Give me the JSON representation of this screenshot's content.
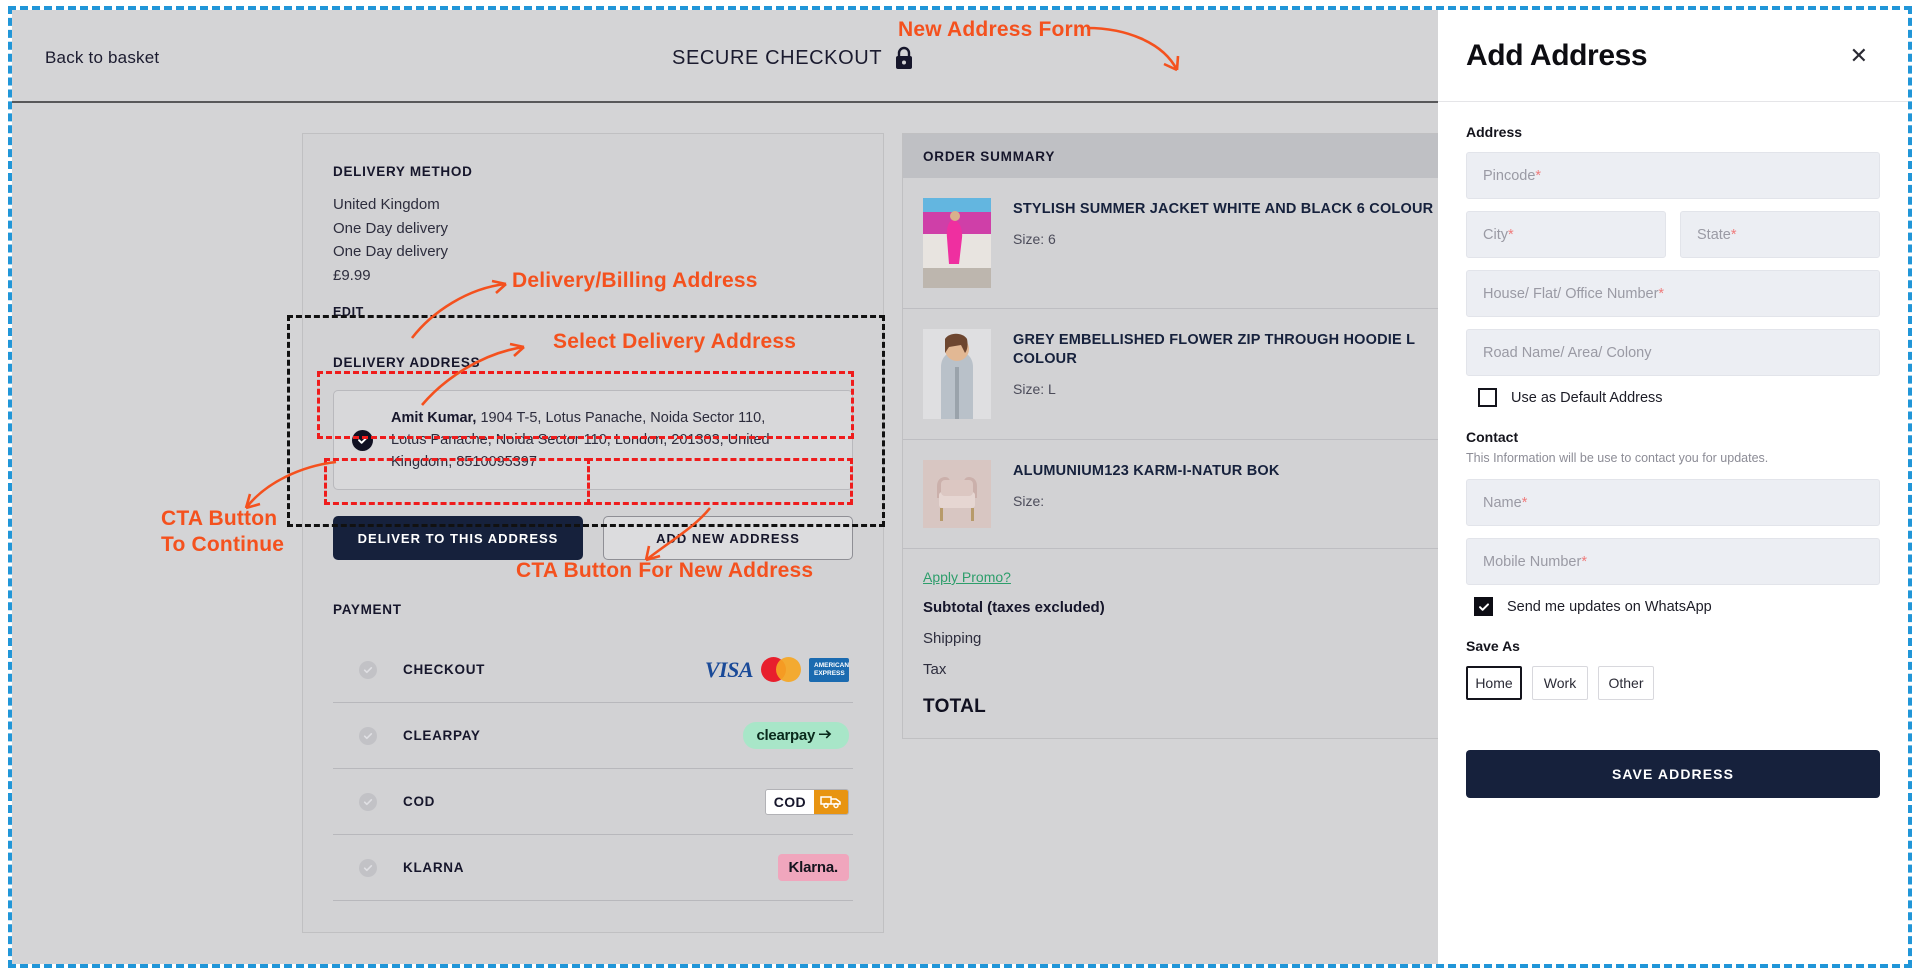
{
  "header": {
    "back_label": "Back to basket",
    "secure_title": "SECURE CHECKOUT",
    "lock_icon": "lock-icon"
  },
  "delivery_method": {
    "label": "DELIVERY METHOD",
    "lines": [
      "United Kingdom",
      "One Day delivery",
      "One Day delivery",
      "£9.99"
    ],
    "edit_label": "EDIT"
  },
  "delivery_address": {
    "label": "DELIVERY ADDRESS",
    "selected_icon": "check-circle-icon",
    "line1_name": "Amit Kumar,",
    "line1_rest": " 1904 T-5, Lotus Panache, Noida Sector 110,",
    "line2": "Lotus Panache, Noida Sector 110, London, 201303, United Kingdom, 8510095397",
    "deliver_button": "DELIVER TO THIS ADDRESS",
    "add_button": "ADD NEW ADDRESS"
  },
  "payment": {
    "label": "PAYMENT",
    "methods": [
      {
        "name": "CHECKOUT",
        "logos": [
          "VISA",
          "mastercard",
          "AMERICAN EXPRESS"
        ]
      },
      {
        "name": "CLEARPAY",
        "logos": [
          "clearpay"
        ]
      },
      {
        "name": "COD",
        "logos": [
          "COD"
        ]
      },
      {
        "name": "KLARNA",
        "logos": [
          "Klarna."
        ]
      }
    ],
    "amex_line1": "AMERICAN",
    "amex_line2": "EXPRESS",
    "visa_text": "VISA",
    "clearpay_text": "clearpay",
    "cod_text": "COD",
    "klarna_text": "Klarna."
  },
  "order_summary": {
    "heading": "ORDER SUMMARY",
    "items": [
      {
        "title": "STYLISH SUMMER JACKET WHITE AND BLACK 6 COLOUR",
        "size_label": "Size: 6",
        "thumb": "product-thumb-jacket"
      },
      {
        "title": "GREY EMBELLISHED FLOWER ZIP THROUGH HOODIE L COLOUR",
        "size_label": "Size: L",
        "thumb": "product-thumb-hoodie"
      },
      {
        "title": "ALUMUNIUM123 KARM-I-NATUR BOK",
        "size_label": "Size:",
        "thumb": "product-thumb-chair"
      }
    ],
    "promo_link": "Apply Promo?",
    "subtotal_label": "Subtotal (taxes excluded)",
    "shipping_label": "Shipping",
    "tax_label": "Tax",
    "total_label": "TOTAL"
  },
  "add_address_panel": {
    "title": "Add Address",
    "close_icon": "close-icon",
    "address_group_label": "Address",
    "pincode_placeholder": "Pincode",
    "city_placeholder": "City",
    "state_placeholder": "State",
    "house_placeholder": "House/ Flat/ Office Number",
    "road_placeholder": "Road Name/ Area/ Colony",
    "required_mark": "*",
    "default_address_label": "Use as Default Address",
    "default_address_checked": false,
    "contact_group_label": "Contact",
    "contact_note": "This Information will be use to contact you for updates.",
    "name_placeholder": "Name",
    "mobile_placeholder": "Mobile Number",
    "whatsapp_label": "Send me updates on WhatsApp",
    "whatsapp_checked": true,
    "save_as_label": "Save As",
    "save_as_options": [
      "Home",
      "Work",
      "Other"
    ],
    "save_as_selected": "Home",
    "save_button": "SAVE ADDRESS"
  },
  "annotations": {
    "new_address_form": "New Address Form",
    "delivery_billing_address": "Delivery/Billing Address",
    "select_delivery_address": "Select Delivery Address",
    "cta_continue": "CTA Button\nTo Continue",
    "cta_new_address": "CTA Button For New Address",
    "accent_color": "#f4511e",
    "black_dash_color": "#111111",
    "red_dash_color": "#ef1c1c",
    "blue_frame_color": "#2196d8"
  }
}
